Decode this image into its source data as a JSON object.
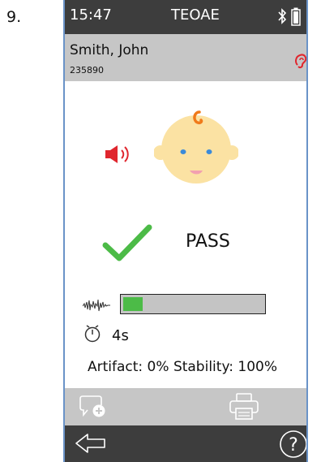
{
  "figure_number": "9.",
  "status_bar": {
    "time": "15:47",
    "mode": "TEOAE",
    "bluetooth_icon": "bluetooth-icon",
    "battery_icon": "battery-icon"
  },
  "patient": {
    "name": "Smith, John",
    "id": "235890",
    "ear_icon": "ear-icon",
    "ear_color": "#e0262e"
  },
  "test": {
    "subject_icon": "baby-face-icon",
    "stimulus_icon": "speaker-icon",
    "result_icon": "checkmark-icon",
    "result": "PASS",
    "progress_fraction": 0.14,
    "duration": "4s",
    "artifact_text": "Artifact: 0%",
    "stability_text": "Stability: 100%"
  },
  "actions": {
    "note_icon": "add-comment-icon",
    "print_icon": "printer-icon"
  },
  "nav": {
    "back_icon": "back-arrow-icon",
    "help_icon": "help-icon"
  },
  "colors": {
    "pass_green": "#4cbb47",
    "bar_dark": "#3d3d3d",
    "bar_light": "#c6c6c6",
    "alert_red": "#e0262e"
  }
}
